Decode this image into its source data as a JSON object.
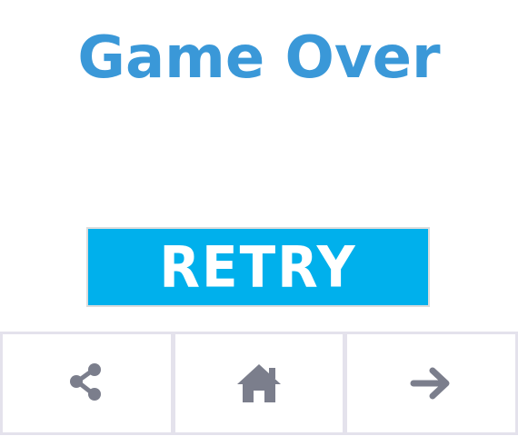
{
  "title": "Game Over",
  "retry": {
    "label": "RETRY"
  },
  "toolbar": {
    "buttons": [
      {
        "icon": "share-icon"
      },
      {
        "icon": "home-icon"
      },
      {
        "icon": "arrow-right-icon"
      }
    ]
  },
  "colors": {
    "title": "#3a98d8",
    "retry_bg": "#00b0ec",
    "retry_text": "#ffffff",
    "icon": "#7b7e8c",
    "border": "#e4e2ec"
  }
}
